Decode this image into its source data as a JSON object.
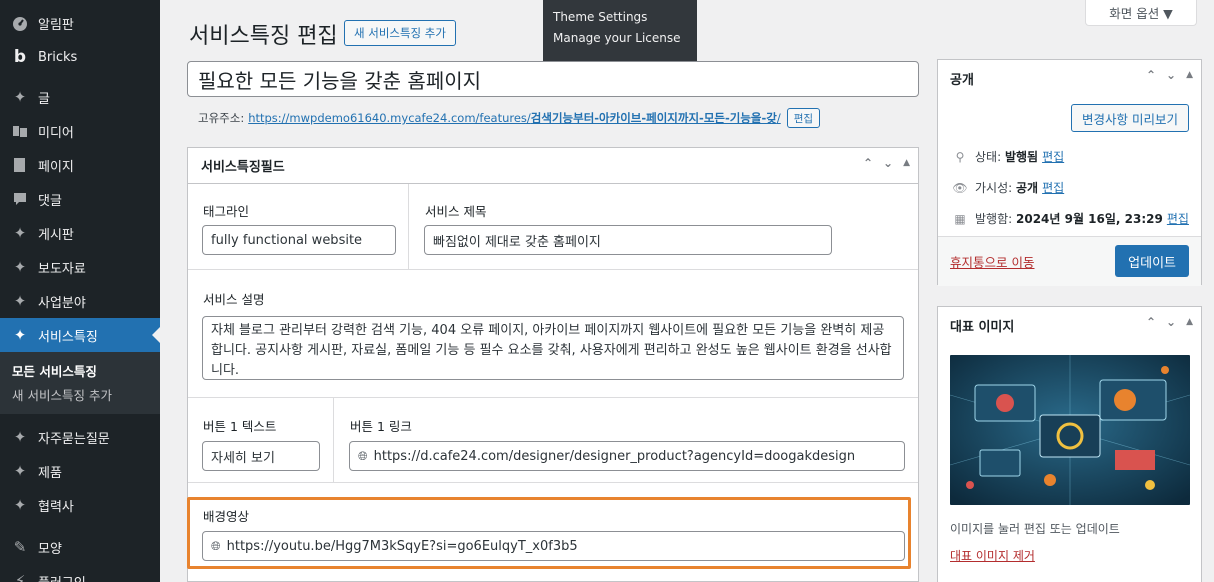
{
  "sidebar": {
    "items": [
      {
        "label": "알림판",
        "icon": "dashboard-icon"
      },
      {
        "label": "Bricks",
        "icon": "bricks-icon"
      },
      {
        "label": "글",
        "icon": "pin-icon"
      },
      {
        "label": "미디어",
        "icon": "media-icon"
      },
      {
        "label": "페이지",
        "icon": "page-icon"
      },
      {
        "label": "댓글",
        "icon": "comment-icon"
      },
      {
        "label": "게시판",
        "icon": "pin-icon"
      },
      {
        "label": "보도자료",
        "icon": "pin-icon"
      },
      {
        "label": "사업분야",
        "icon": "pin-icon"
      },
      {
        "label": "서비스특징",
        "icon": "pin-icon"
      },
      {
        "label": "자주묻는질문",
        "icon": "pin-icon"
      },
      {
        "label": "제품",
        "icon": "pin-icon"
      },
      {
        "label": "협력사",
        "icon": "pin-icon"
      },
      {
        "label": "모양",
        "icon": "brush-icon"
      },
      {
        "label": "플러그인",
        "icon": "plugin-icon"
      }
    ],
    "submenu": [
      "모든 서비스특징",
      "새 서비스특징 추가"
    ]
  },
  "dropdown": {
    "items": [
      "Theme Settings",
      "Manage your License"
    ]
  },
  "screen_options": "화면 옵션 ▼",
  "header": {
    "title": "서비스특징 편집",
    "add_new": "새 서비스특징 추가"
  },
  "post_title": "필요한 모든 기능을 갖춘 홈페이지",
  "permalink": {
    "label": "고유주소:",
    "url_base": "https://mwpdemo61640.mycafe24.com/features/",
    "slug": "검색기능부터-아카이브-페이지까지-모든-기능을-갖",
    "trailing": "/",
    "edit": "편집"
  },
  "metabox": {
    "title": "서비스특징필드",
    "tagline_label": "태그라인",
    "tagline_value": "fully functional website",
    "service_title_label": "서비스 제목",
    "service_title_value": "빠짐없이 제대로 갖춘 홈페이지",
    "description_label": "서비스 설명",
    "description_value": "자체 블로그 관리부터 강력한 검색 기능, 404 오류 페이지, 아카이브 페이지까지 웹사이트에 필요한 모든 기능을 완벽히 제공합니다. 공지사항 게시판, 자료실, 폼메일 기능 등 필수 요소를 갖춰, 사용자에게 편리하고 완성도 높은 웹사이트 환경을 선사합니다.",
    "button1_text_label": "버튼 1 텍스트",
    "button1_text_value": "자세히 보기",
    "button1_link_label": "버튼 1 링크",
    "button1_link_value": "https://d.cafe24.com/designer/designer_product?agencyId=doogakdesign",
    "bg_video_label": "배경영상",
    "bg_video_value": "https://youtu.be/Hgg7M3kSqyE?si=go6EulqyT_x0f3b5"
  },
  "publish": {
    "title": "공개",
    "preview": "변경사항 미리보기",
    "status_label": "상태:",
    "status_value": "발행됨",
    "visibility_label": "가시성:",
    "visibility_value": "공개",
    "published_label": "발행함:",
    "published_value": "2024년 9월 16일, 23:29",
    "edit": "편집",
    "trash": "휴지통으로 이동",
    "update": "업데이트"
  },
  "featured": {
    "title": "대표 이미지",
    "caption": "이미지를 눌러 편집 또는 업데이트",
    "remove": "대표 이미지 제거"
  },
  "colors": {
    "accent": "#2271b1",
    "sidebar": "#1d2327",
    "highlight": "#e8832e",
    "danger": "#b32d2e"
  }
}
